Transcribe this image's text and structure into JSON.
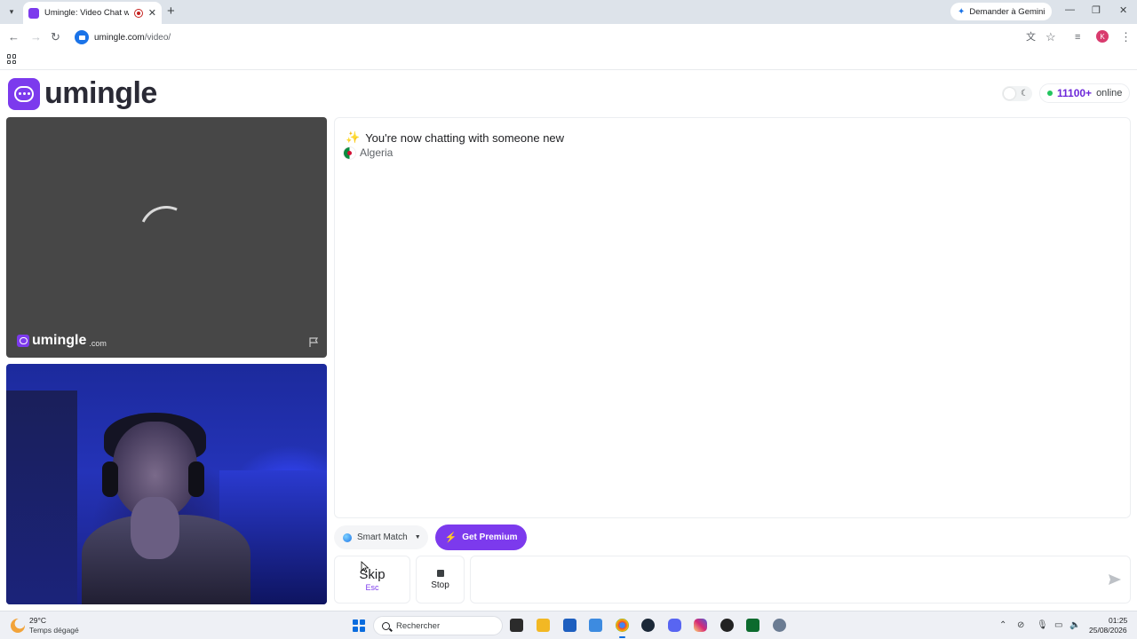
{
  "browser": {
    "tab": {
      "title": "Umingle: Video Chat with S"
    },
    "gemini_label": "Demander à Gemini",
    "url_host": "umingle.com",
    "url_path": "/video/",
    "profile_initial": "K"
  },
  "header": {
    "logo_text": "umingle",
    "online_count": "11100+",
    "online_label": "online"
  },
  "stranger_video": {
    "watermark": "umingle",
    "watermark_domain": ".com"
  },
  "chat": {
    "messages": [
      {
        "text": "You're now chatting with someone new"
      }
    ],
    "partner_country": "Algeria"
  },
  "controls": {
    "match_mode": "Smart Match",
    "premium_label": "Get Premium",
    "skip_label": "Skip",
    "skip_shortcut": "Esc",
    "stop_label": "Stop",
    "message_placeholder": ""
  },
  "taskbar": {
    "weather_temp": "29°C",
    "weather_desc": "Temps dégagé",
    "search_placeholder": "Rechercher",
    "time": "01:25",
    "date": "25/08/2026"
  },
  "colors": {
    "brand": "#7c3aed",
    "online": "#22c55e",
    "accent_text": "#6d28d9"
  }
}
